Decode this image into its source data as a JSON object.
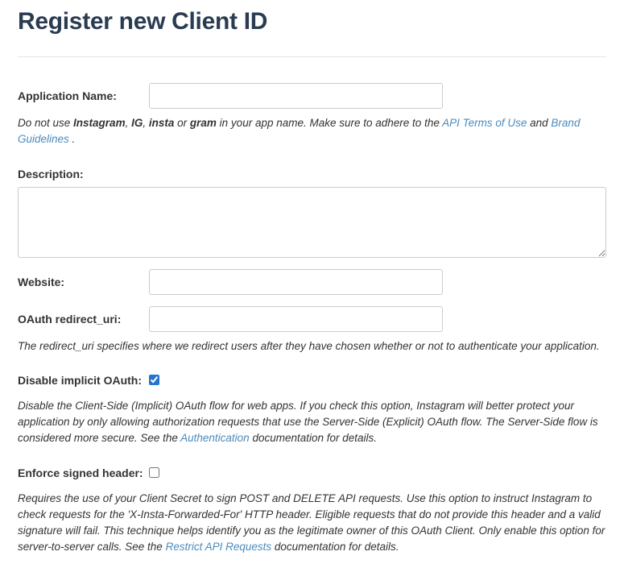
{
  "page_title": "Register new Client ID",
  "fields": {
    "app_name_label": "Application Name:",
    "app_name_value": "",
    "app_name_help_prefix": "Do not use ",
    "app_name_help_banned1": "Instagram",
    "app_name_help_sep1": ", ",
    "app_name_help_banned2": "IG",
    "app_name_help_sep2": ", ",
    "app_name_help_banned3": "insta",
    "app_name_help_or": " or ",
    "app_name_help_banned4": "gram",
    "app_name_help_mid": " in your app name. Make sure to adhere to the ",
    "app_name_help_link1": "API Terms of Use",
    "app_name_help_and": " and ",
    "app_name_help_link2": "Brand Guidelines",
    "app_name_help_end": " .",
    "description_label": "Description:",
    "description_value": "",
    "website_label": "Website:",
    "website_value": "",
    "oauth_label": "OAuth redirect_uri:",
    "oauth_value": "",
    "oauth_help": "The redirect_uri specifies where we redirect users after they have chosen whether or not to authenticate your application.",
    "disable_implicit_label": "Disable implicit OAuth:",
    "disable_implicit_help_pre": "Disable the Client-Side (Implicit) OAuth flow for web apps. If you check this option, Instagram will better protect your application by only allowing authorization requests that use the Server-Side (Explicit) OAuth flow. The Server-Side flow is considered more secure. See the ",
    "disable_implicit_help_link": "Authentication",
    "disable_implicit_help_post": " documentation for details.",
    "enforce_signed_label": "Enforce signed header:",
    "enforce_signed_help_pre": "Requires the use of your Client Secret to sign POST and DELETE API requests. Use this option to instruct Instagram to check requests for the 'X-Insta-Forwarded-For' HTTP header. Eligible requests that do not provide this header and a valid signature will fail. This technique helps identify you as the legitimate owner of this OAuth Client. Only enable this option for server-to-server calls. See the ",
    "enforce_signed_help_link": "Restrict API Requests",
    "enforce_signed_help_post": " documentation for details."
  }
}
